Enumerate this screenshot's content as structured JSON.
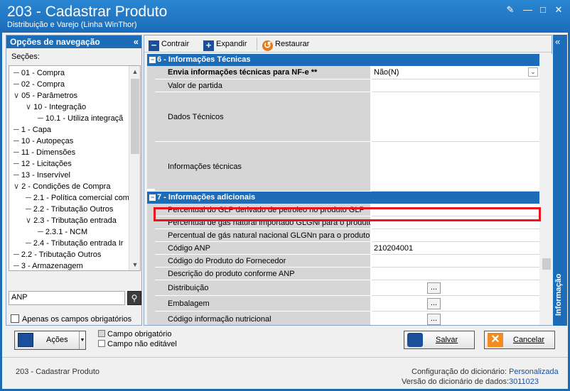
{
  "window": {
    "title": "203 - Cadastrar  Produto",
    "subtitle": "Distribuição e Varejo (Linha WinThor)"
  },
  "nav": {
    "header": "Opções de navegação",
    "sections_label": "Seções:",
    "tree": [
      {
        "label": "01 - Compra",
        "indent": 0
      },
      {
        "label": "02 - Compra",
        "indent": 0
      },
      {
        "label": "05 - Parâmetros",
        "indent": 0,
        "expanded": true
      },
      {
        "label": "10 - Integração",
        "indent": 1,
        "expanded": true
      },
      {
        "label": "10.1 - Utiliza integraçã",
        "indent": 2
      },
      {
        "label": "1 - Capa",
        "indent": 0
      },
      {
        "label": "10 - Autopeças",
        "indent": 0
      },
      {
        "label": "11 - Dimensões",
        "indent": 0
      },
      {
        "label": "12 - Licitações",
        "indent": 0
      },
      {
        "label": "13 - Inservível",
        "indent": 0
      },
      {
        "label": "2 - Condições de Compra",
        "indent": 0,
        "expanded": true
      },
      {
        "label": "2.1 - Política comercial com",
        "indent": 1
      },
      {
        "label": "2.2 - Tributação Outros",
        "indent": 1
      },
      {
        "label": "2.3 - Tributação entrada",
        "indent": 1,
        "expanded": true
      },
      {
        "label": "2.3.1 - NCM",
        "indent": 2
      },
      {
        "label": "2.4 - Tributação entrada Ir",
        "indent": 1
      },
      {
        "label": "2.2 - Tributação Outros",
        "indent": 0
      },
      {
        "label": "3 - Armazenagem",
        "indent": 0
      }
    ],
    "search_value": "ANP",
    "only_required_label": "Apenas os campos obrigatórios"
  },
  "toolbar": {
    "collapse_label": "Contrair",
    "expand_label": "Expandir",
    "restore_label": "Restaurar"
  },
  "groups": {
    "g6": "6 - Informações Técnicas",
    "g7": "7 - Informações adicionais"
  },
  "fields": {
    "envia": {
      "label": "Envia informações técnicas para NF-e **",
      "value": "Não(N)"
    },
    "valor_partida": {
      "label": "Valor de partida",
      "value": ""
    },
    "dados_tecnicos": {
      "label": "Dados Técnicos",
      "value": ""
    },
    "info_tecnicas": {
      "label": "Informações técnicas",
      "value": ""
    },
    "perc_glp": {
      "label": "Percentual do GLP derivado de petroleo no produto GLP",
      "value": ""
    },
    "perc_gn_imp": {
      "label": "Percentual de gás natural importado GLGNi para o produto",
      "value": ""
    },
    "perc_gn_nac": {
      "label": "Percentual de gás natural nacional GLGNn para o produto G",
      "value": ""
    },
    "codigo_anp": {
      "label": "Código ANP",
      "value": "210204001"
    },
    "cod_fornecedor": {
      "label": "Código do Produto do Fornecedor",
      "value": ""
    },
    "desc_anp": {
      "label": "Descrição do produto conforme ANP",
      "value": ""
    },
    "distribuicao": {
      "label": "Distribuição",
      "value": ""
    },
    "embalagem": {
      "label": "Embalagem",
      "value": ""
    },
    "cod_nutricional": {
      "label": "Código informação nutricional",
      "value": ""
    }
  },
  "info_panel": {
    "label": "Informação"
  },
  "footer": {
    "actions_label": "Ações",
    "legend_required": "Campo obrigatório",
    "legend_not_editable": "Campo não editável",
    "save_label": "Salvar",
    "cancel_label": "Cancelar",
    "status_left": "203 - Cadastrar  Produto",
    "dict_config_label": "Configuração do dicionário:",
    "dict_config_value": "Personalizada",
    "dict_version_label": "Versão do dicionário de dados:",
    "dict_version_value": "3011023"
  }
}
